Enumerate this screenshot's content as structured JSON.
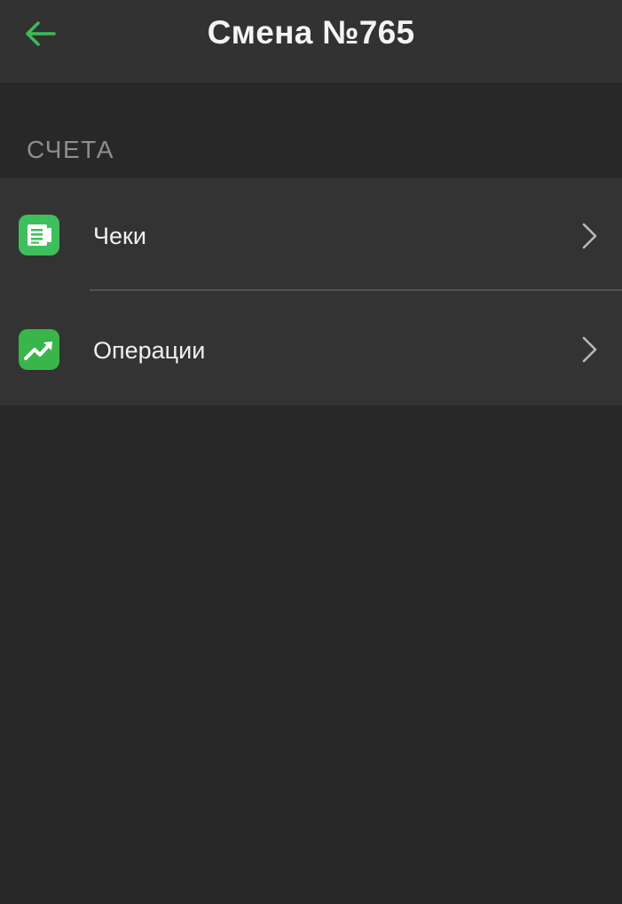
{
  "header": {
    "title": "Смена №765",
    "back_icon": "arrow-left-icon"
  },
  "section": {
    "title": "СЧЕТА"
  },
  "items": [
    {
      "label": "Чеки",
      "icon": "receipt-icon",
      "icon_color": "#3fbf5b"
    },
    {
      "label": "Операции",
      "icon": "chart-trending-up-icon",
      "icon_color": "#3ab54a"
    }
  ],
  "colors": {
    "accent": "#3dbb57",
    "background": "#282828",
    "app_bar": "#323232",
    "list_background": "#333333",
    "section_text": "#8e8e8e"
  }
}
